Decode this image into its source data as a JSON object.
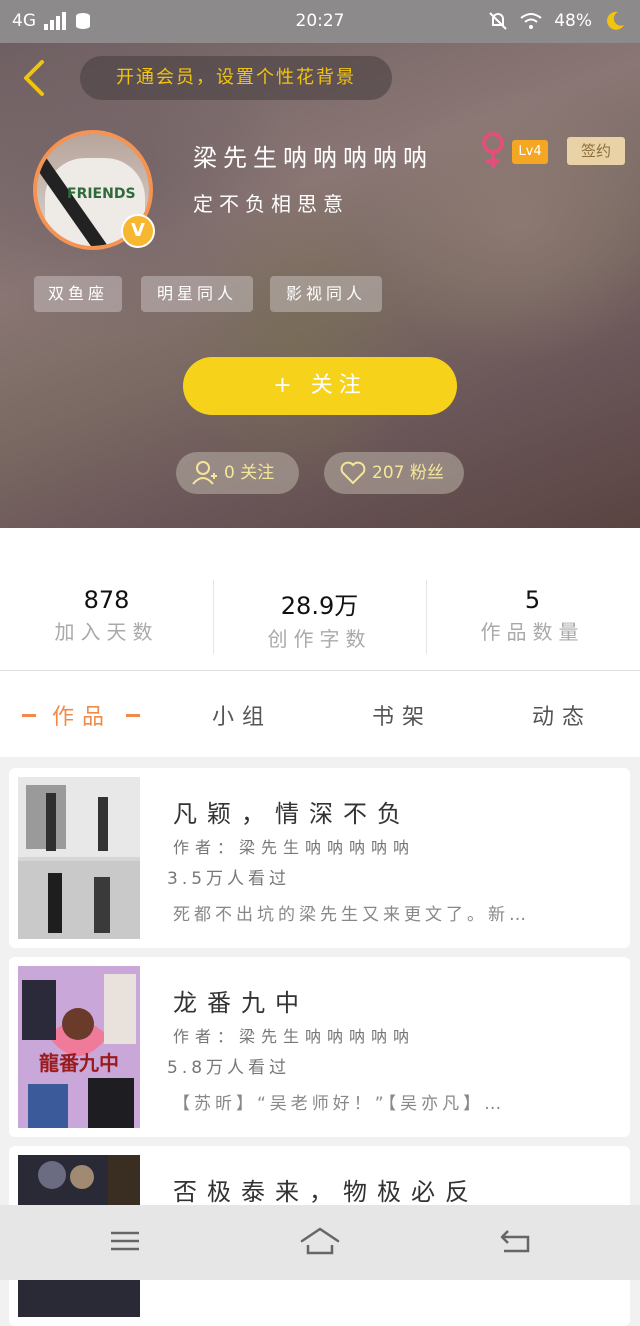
{
  "status": {
    "network": "4G",
    "time": "20:27",
    "battery": "48%"
  },
  "header": {
    "bg_hint": "开通会员，设置个性花背景"
  },
  "profile": {
    "username": "梁先生呐呐呐呐呐",
    "level": "Lv4",
    "sign_label": "签约",
    "signature": "定不负相思意",
    "verified": "V",
    "avatar_text": "FRIENDS",
    "tags": [
      "双鱼座",
      "明星同人",
      "影视同人"
    ]
  },
  "actions": {
    "follow": "+ 关注",
    "following": "0 关注",
    "fans": "207 粉丝"
  },
  "stats": [
    {
      "value": "878",
      "label": "加入天数"
    },
    {
      "value": "28.9万",
      "label": "创作字数"
    },
    {
      "value": "5",
      "label": "作品数量"
    }
  ],
  "tabs": [
    "作品",
    "小组",
    "书架",
    "动态"
  ],
  "works": [
    {
      "title": "凡颖，情深不负",
      "author": "作者：梁先生呐呐呐呐呐",
      "views": "3.5万人看过",
      "desc": "死都不出坑的梁先生又来更文了。新…"
    },
    {
      "title": "龙番九中",
      "author": "作者：梁先生呐呐呐呐呐",
      "views": "5.8万人看过",
      "desc": "【苏昕】“吴老师好！”【吴亦凡】…",
      "cover_text": "龍番九中"
    },
    {
      "title": "否极泰来，物极必反",
      "author": "",
      "views": "",
      "desc": ""
    }
  ],
  "colors": {
    "accent": "#f08a4b",
    "follow": "#f7d21a",
    "gold": "#f1c40f"
  },
  "icons": [
    "back-arrow-icon",
    "female-icon",
    "add-user-icon",
    "heart-icon",
    "menu-icon",
    "home-icon",
    "return-icon"
  ]
}
